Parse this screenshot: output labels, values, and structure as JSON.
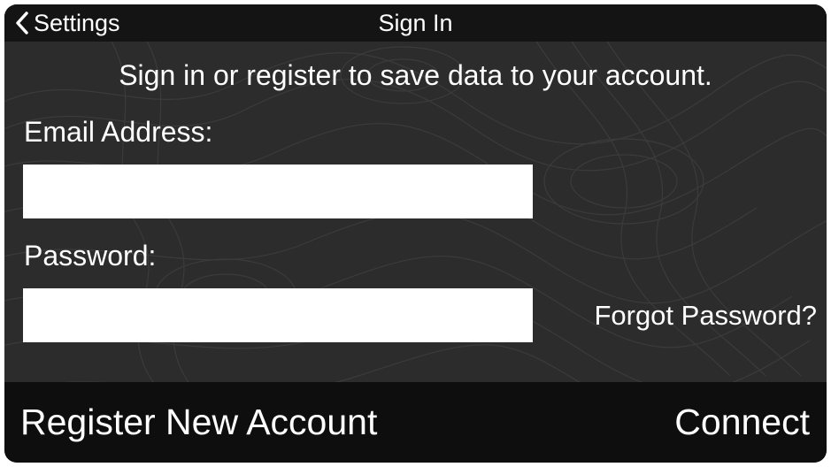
{
  "navbar": {
    "back_label": "Settings",
    "back_icon": "chevron-left-icon",
    "title": "Sign In"
  },
  "intro_text": "Sign in or register to save data to your account.",
  "email": {
    "label": "Email Address:",
    "value": "",
    "placeholder": ""
  },
  "password": {
    "label": "Password:",
    "value": "",
    "placeholder": ""
  },
  "forgot_password": "Forgot Password?",
  "bottom_bar": {
    "register_label": "Register New Account",
    "connect_label": "Connect"
  },
  "colors": {
    "background": "#2c2c2c",
    "bars": "#141414",
    "text": "#ffffff",
    "field": "#ffffff"
  }
}
